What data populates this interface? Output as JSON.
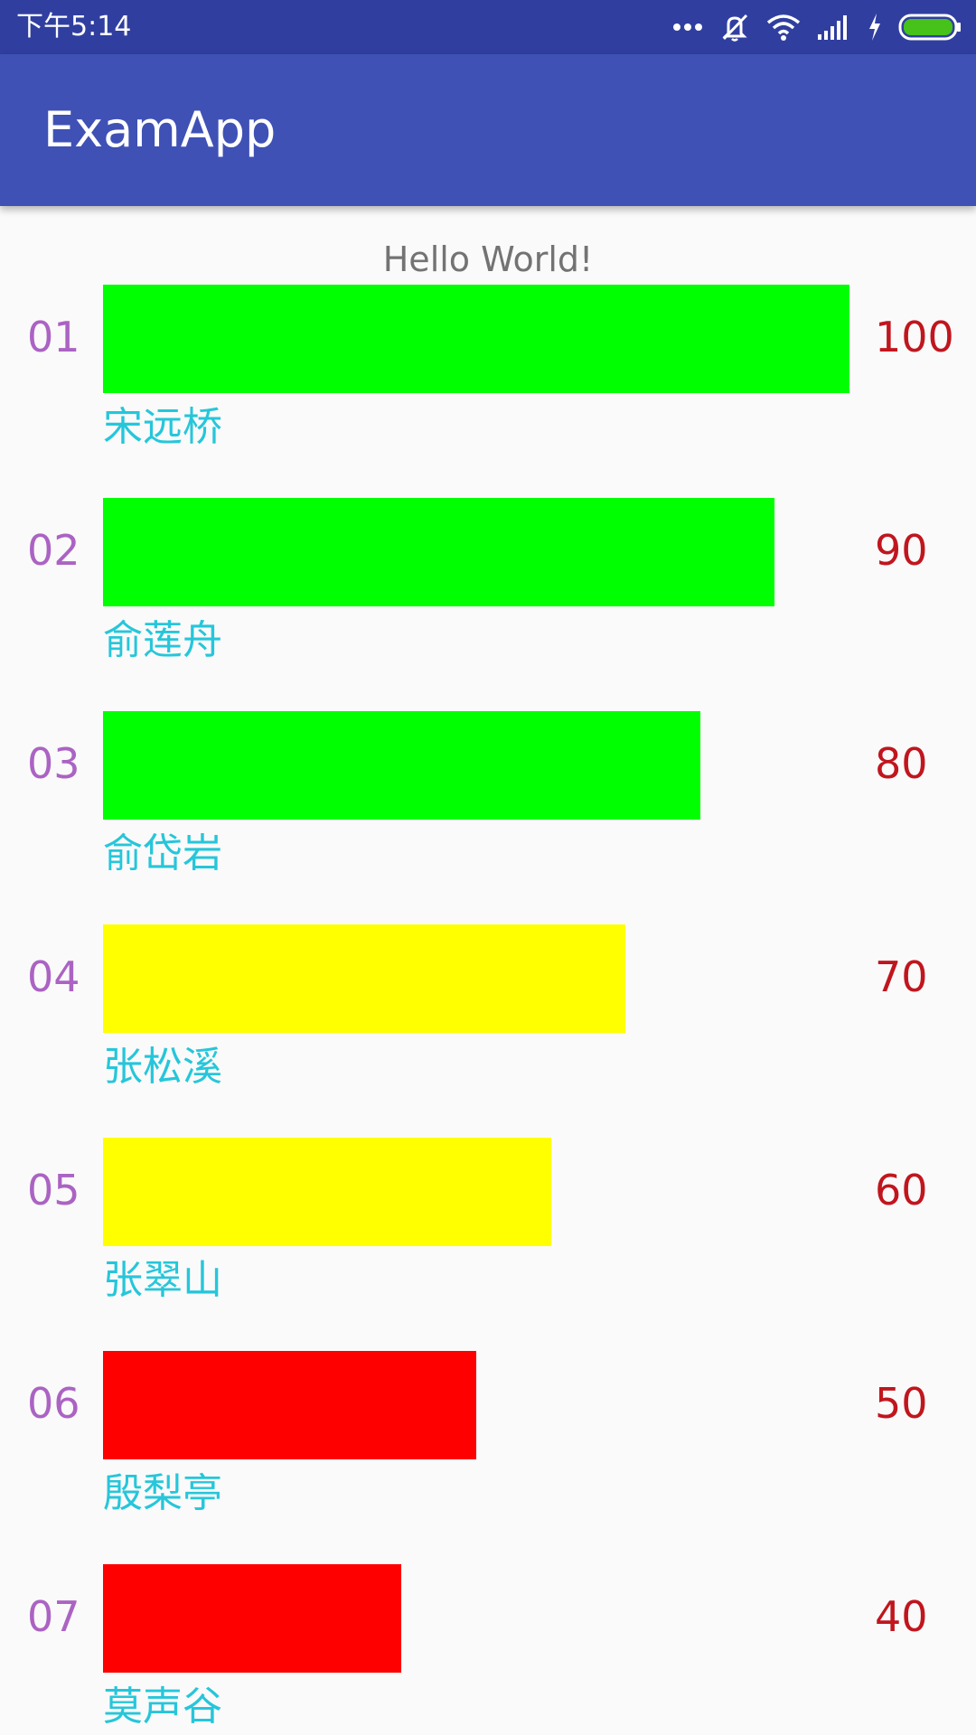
{
  "status_bar": {
    "time": "下午5:14",
    "icons": [
      "more-icon",
      "vibrate-off-icon",
      "wifi-icon",
      "signal-icon",
      "charging-icon",
      "battery-icon"
    ],
    "color": "#303f9f"
  },
  "app_bar": {
    "title": "ExamApp",
    "color": "#3f51b5"
  },
  "main": {
    "greeting": "Hello World!",
    "max_score": 100,
    "rows": [
      {
        "rank": "01",
        "name": "宋远桥",
        "score": "100",
        "value": 100,
        "bar_color": "#00ff00"
      },
      {
        "rank": "02",
        "name": "俞莲舟",
        "score": "90",
        "value": 90,
        "bar_color": "#00ff00"
      },
      {
        "rank": "03",
        "name": "俞岱岩",
        "score": "80",
        "value": 80,
        "bar_color": "#00ff00"
      },
      {
        "rank": "04",
        "name": "张松溪",
        "score": "70",
        "value": 70,
        "bar_color": "#ffff00"
      },
      {
        "rank": "05",
        "name": "张翠山",
        "score": "60",
        "value": 60,
        "bar_color": "#ffff00"
      },
      {
        "rank": "06",
        "name": "殷梨亭",
        "score": "50",
        "value": 50,
        "bar_color": "#ff0000"
      },
      {
        "rank": "07",
        "name": "莫声谷",
        "score": "40",
        "value": 40,
        "bar_color": "#ff0000"
      }
    ]
  },
  "colors": {
    "rank_text": "#ab63c3",
    "score_text": "#c0161e",
    "name_text": "#26c6da",
    "greeting_text": "#737373"
  }
}
